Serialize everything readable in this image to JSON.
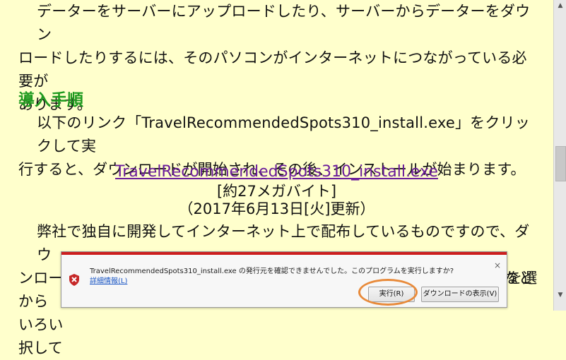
{
  "content": {
    "intro_lines": [
      "データーをサーバーにアップロードしたり、サーバーからデーターをダウン",
      "ロードしたりするには、そのパソコンがインターネットにつながっている必要が",
      "あります。"
    ],
    "heading": "導入手順",
    "steps_lines": [
      "以下のリンク「TravelRecommendedSpots310_install.exe」をクリックして実",
      "行すると、ダウンロードが開始され、その後、インストールが始まります。"
    ],
    "download_link": "TravelRecommendedSpots310_install.exe",
    "file_size": "[約27メガバイト]",
    "updated": "（2017年6月13日[火]更新）",
    "notice_lines": [
      "弊社で独自に開発してインターネット上で配布しているものですので、ダウ",
      "ンロードする際やインストールする際、Windowsやセキュリティソフトなどから",
      "いろい",
      "択して"
    ],
    "notice_right": "を選"
  },
  "dialog": {
    "message": "TravelRecommendedSpots310_install.exe の発行元を確認できませんでした。このプログラムを実行しますか?",
    "details_link": "詳細情報(L)",
    "run_button": "実行(R)",
    "view_downloads_button": "ダウンロードの表示(V)",
    "close_symbol": "×"
  },
  "colors": {
    "background": "#ffffcc",
    "heading": "#1f9a1f",
    "link": "#6a1b9a",
    "dialog_bar": "#cc1e1e",
    "highlight": "#e88a3a"
  },
  "icons": {
    "scroll_up": "▲",
    "scroll_down": "▼"
  }
}
